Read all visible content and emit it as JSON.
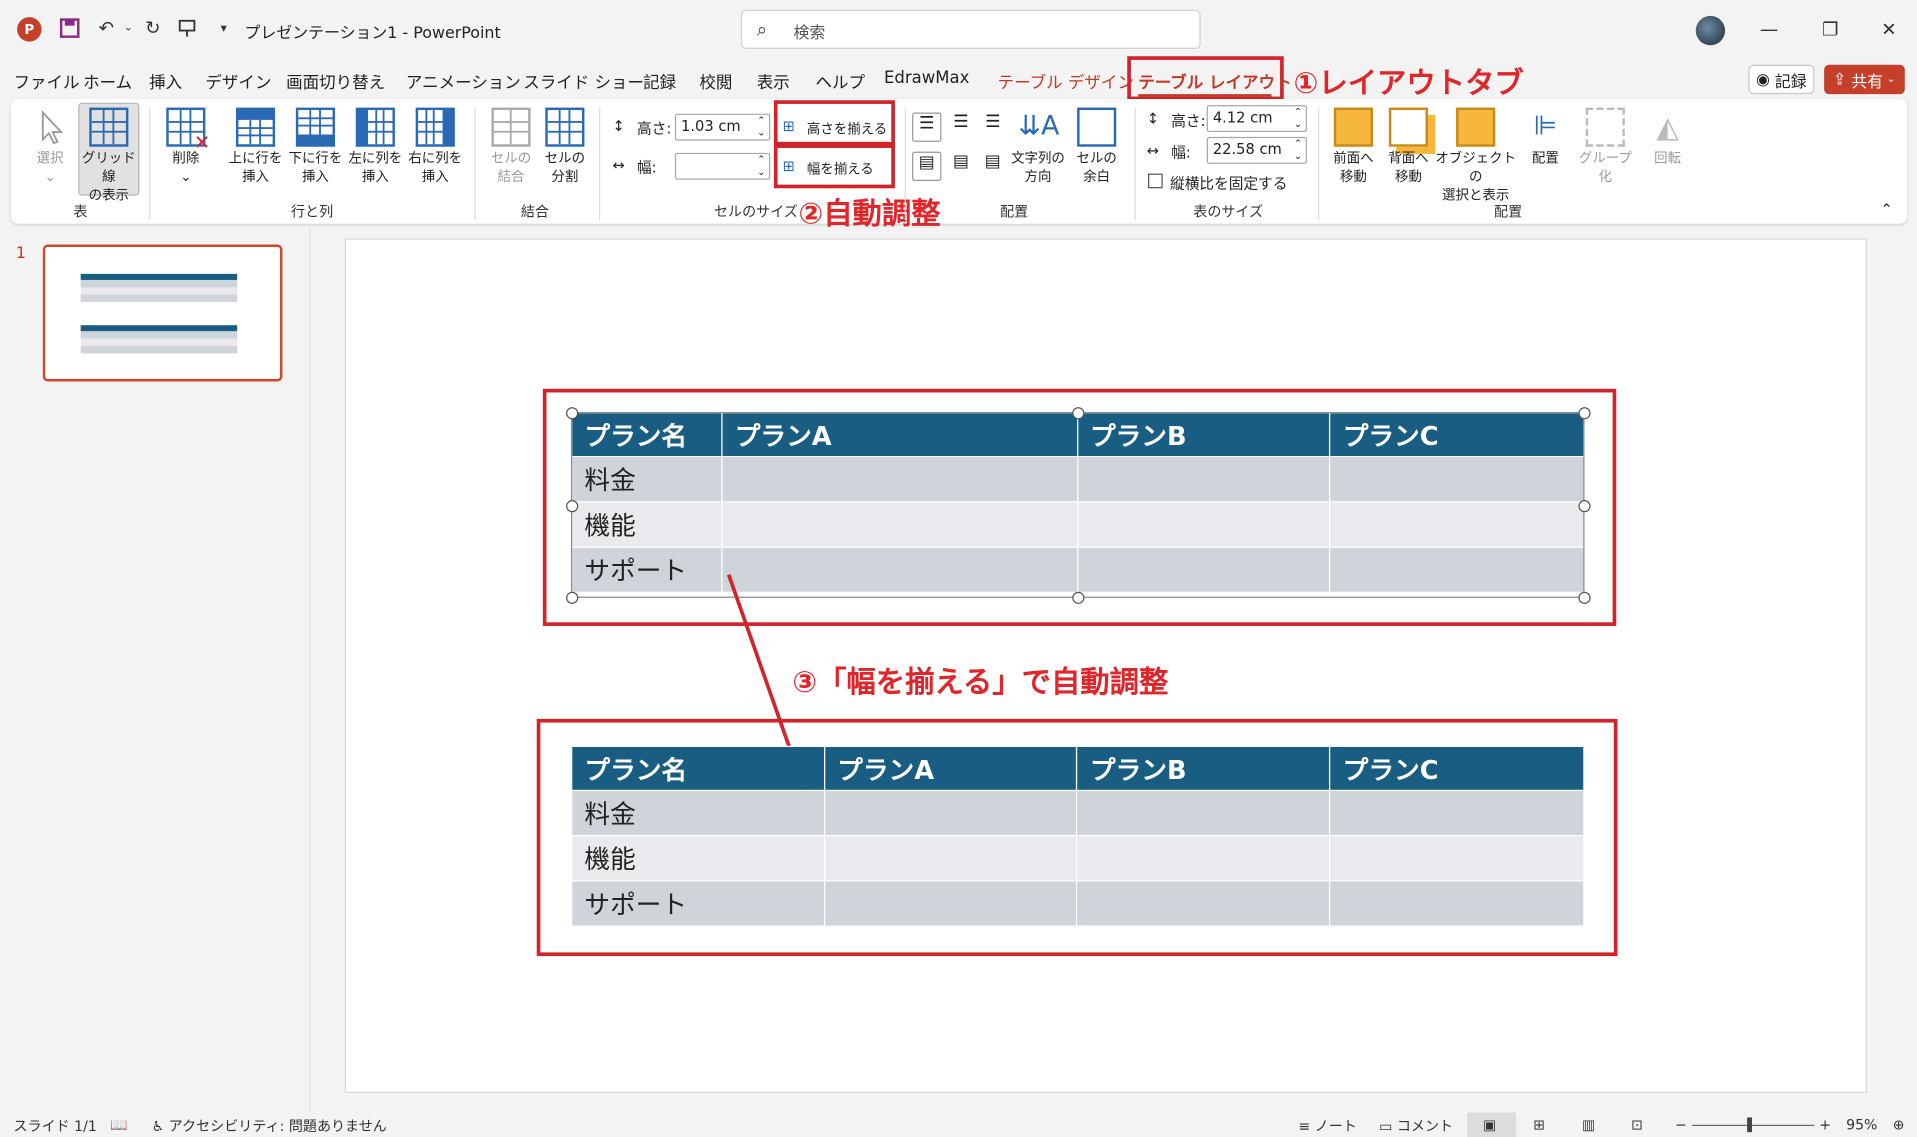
{
  "titlebar": {
    "app_icon": "powerpoint-icon",
    "doc_title": "プレゼンテーション1  -  PowerPoint",
    "search_placeholder": "検索"
  },
  "menu": {
    "items": [
      "ファイル",
      "ホーム",
      "挿入",
      "デザイン",
      "画面切り替え",
      "アニメーション",
      "スライド ショー",
      "記録",
      "校閲",
      "表示",
      "ヘルプ",
      "EdrawMax"
    ],
    "table_design": "テーブル デザイン",
    "table_layout": "テーブル レイアウト",
    "record_btn": "記録",
    "share_btn": "共有"
  },
  "annotations": {
    "a1": "①レイアウトタブ",
    "a2": "②自動調整",
    "a3": "③「幅を揃える」で自動調整"
  },
  "ribbon": {
    "select": "選択",
    "gridlines": "グリッド線\nの表示",
    "delete": "削除",
    "insert_above": "上に行を\n挿入",
    "insert_below": "下に行を\n挿入",
    "insert_left": "左に列を\n挿入",
    "insert_right": "右に列を\n挿入",
    "merge_cells": "セルの\n結合",
    "split_cells": "セルの\n分割",
    "cell_height_label": "高さ:",
    "cell_height_value": "1.03 cm",
    "cell_width_label": "幅:",
    "cell_width_value": "",
    "distribute_rows": "高さを揃える",
    "distribute_cols": "幅を揃える",
    "text_direction": "文字列の\n方向",
    "cell_margins": "セルの\n余白",
    "table_height_label": "高さ:",
    "table_height_value": "4.12 cm",
    "table_width_label": "幅:",
    "table_width_value": "22.58 cm",
    "lock_ratio": "縦横比を固定する",
    "bring_forward": "前面へ\n移動",
    "send_backward": "背面へ\n移動",
    "selection_pane": "オブジェクトの\n選択と表示",
    "align": "配置",
    "group": "グループ化",
    "rotate": "回転",
    "groups": [
      "表",
      "行と列",
      "結合",
      "セルのサイズ",
      "配置",
      "表のサイズ",
      "配置"
    ]
  },
  "thumbs": {
    "number": "1"
  },
  "table_top": {
    "header": [
      "プラン名",
      "プランA",
      "プランB",
      "プランC"
    ],
    "rows": [
      [
        "料金",
        "",
        "",
        ""
      ],
      [
        "機能",
        "",
        "",
        ""
      ],
      [
        "サポート",
        "",
        "",
        ""
      ]
    ]
  },
  "table_bottom": {
    "header": [
      "プラン名",
      "プランA",
      "プランB",
      "プランC"
    ],
    "rows": [
      [
        "料金",
        "",
        "",
        ""
      ],
      [
        "機能",
        "",
        "",
        ""
      ],
      [
        "サポート",
        "",
        "",
        ""
      ]
    ]
  },
  "status": {
    "slide": "スライド 1/1",
    "accessibility": "アクセシビリティ: 問題ありません",
    "notes": "ノート",
    "comments": "コメント",
    "zoom": "95%"
  },
  "colors": {
    "accent_red": "#d2232a",
    "table_header": "#1a5d82",
    "ppt_brand": "#c4402a"
  }
}
